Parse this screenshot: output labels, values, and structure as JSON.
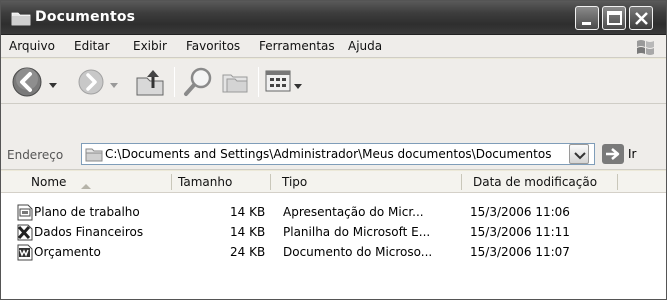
{
  "window": {
    "title": "Documentos"
  },
  "menu": [
    "Arquivo",
    "Editar",
    "Exibir",
    "Favoritos",
    "Ferramentas",
    "Ajuda"
  ],
  "toolbar": {
    "buttons": [
      "back-icon",
      "forward-icon",
      "up-folder-icon",
      "search-icon",
      "folders-icon",
      "views-icon"
    ]
  },
  "address": {
    "label": "Endereço",
    "path": "C:\\Documents and Settings\\Administrador\\Meus documentos\\Documentos",
    "go_label": "Ir"
  },
  "columns": {
    "name": "Nome",
    "size": "Tamanho",
    "type": "Tipo",
    "modified": "Data de modificação"
  },
  "files": [
    {
      "name": "Plano de trabalho",
      "size": "14 KB",
      "type": "Apresentação do Micr...",
      "modified": "15/3/2006 11:06",
      "icon": "powerpoint-icon"
    },
    {
      "name": "Dados Financeiros",
      "size": "14 KB",
      "type": "Planilha do Microsoft E...",
      "modified": "15/3/2006 11:11",
      "icon": "excel-icon"
    },
    {
      "name": "Orçamento",
      "size": "24 KB",
      "type": "Documento do Microso...",
      "modified": "15/3/2006 11:07",
      "icon": "word-icon"
    }
  ]
}
